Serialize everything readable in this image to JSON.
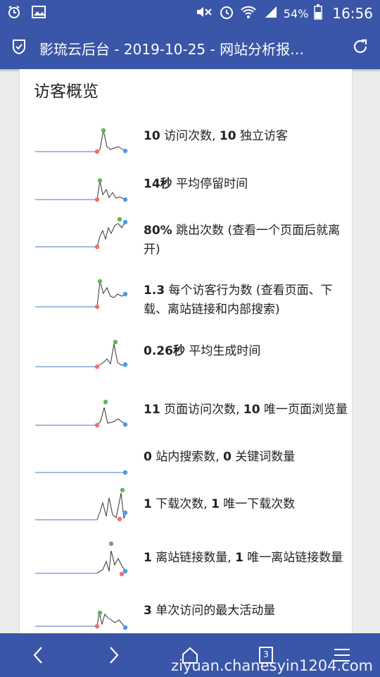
{
  "status_bar": {
    "battery": "54%",
    "time": "16:56",
    "icons": [
      "alarm-icon",
      "image-icon",
      "mute-icon",
      "alarm-clock-icon",
      "wifi-icon",
      "signal-icon",
      "battery-icon"
    ]
  },
  "app_bar": {
    "title": "影琉云后台 - 2019-10-25 - 网站分析报…"
  },
  "card": {
    "title": "访客概览",
    "metrics": [
      {
        "value": "10",
        "text": " 访问次数, ",
        "value2": "10",
        "text2": " 独立访客"
      },
      {
        "value": "14秒",
        "text": " 平均停留时间",
        "value2": "",
        "text2": ""
      },
      {
        "value": "80%",
        "text": " 跳出次数 (查看一个页面后就离开)",
        "value2": "",
        "text2": ""
      },
      {
        "value": "1.3",
        "text": " 每个访客行为数 (查看页面、下载、离站链接和内部搜索)",
        "value2": "",
        "text2": ""
      },
      {
        "value": "0.26秒",
        "text": " 平均生成时间",
        "value2": "",
        "text2": ""
      },
      {
        "value": "11",
        "text": " 页面访问次数, ",
        "value2": "10",
        "text2": " 唯一页面浏览量"
      },
      {
        "value": "0",
        "text": " 站内搜索数, ",
        "value2": "0",
        "text2": " 关键词数量"
      },
      {
        "value": "1",
        "text": " 下载次数, ",
        "value2": "1",
        "text2": " 唯一下载次数"
      },
      {
        "value": "1",
        "text": " 离站链接数量, ",
        "value2": "1",
        "text2": " 唯一离站链接数量"
      },
      {
        "value": "3",
        "text": " 单次访问的最大活动量",
        "value2": "",
        "text2": ""
      }
    ]
  },
  "bottom_nav": {
    "tab_count": "3",
    "watermark": "ziyuan.chanesyin1204.com"
  },
  "colors": {
    "bar": "#3a56a8",
    "spark_flat": "#6f8fd0",
    "min_dot": "#f07070",
    "max_dot": "#5cb85c",
    "last_dot": "#4a9de8"
  }
}
